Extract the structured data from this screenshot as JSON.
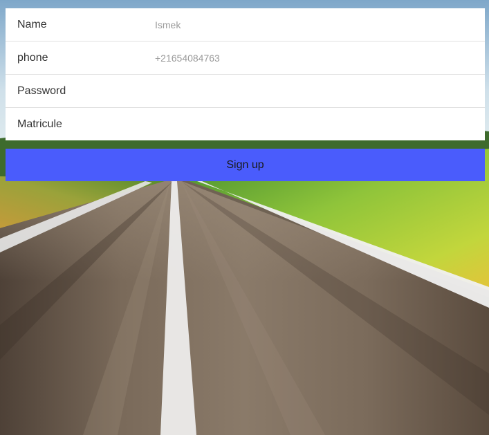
{
  "form": {
    "fields": [
      {
        "label": "Name",
        "value": "Ismek"
      },
      {
        "label": "phone",
        "value": "+21654084763"
      },
      {
        "label": "Password",
        "value": ""
      },
      {
        "label": "Matricule",
        "value": ""
      }
    ],
    "submit_label": "Sign up"
  },
  "colors": {
    "button": "#4a5cfc",
    "form_bg": "#ffffff",
    "label": "#333333",
    "value": "#9a9a9a"
  },
  "icons": []
}
